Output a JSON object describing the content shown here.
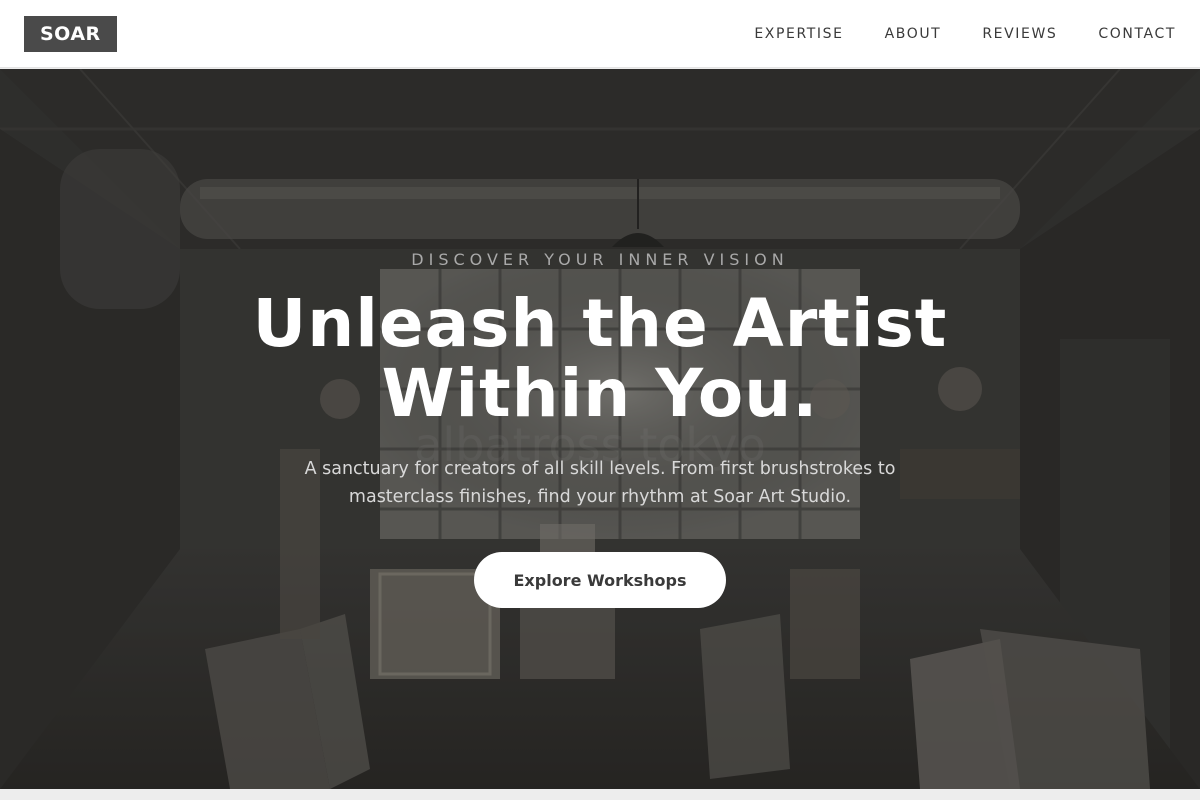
{
  "brand": {
    "logo_text": "SOAR"
  },
  "nav": {
    "items": [
      {
        "label": "EXPERTISE"
      },
      {
        "label": "ABOUT"
      },
      {
        "label": "REVIEWS"
      },
      {
        "label": "CONTACT"
      }
    ]
  },
  "hero": {
    "eyebrow": "DISCOVER YOUR INNER VISION",
    "headline": "Unleash the Artist Within You.",
    "subtext": "A sanctuary for creators of all skill levels. From first brushstrokes to masterclass finishes, find your rhythm at Soar Art Studio.",
    "cta_label": "Explore Workshops",
    "watermark": "albatross tokyo"
  },
  "colors": {
    "nav_background": "#ffffff",
    "logo_background": "#4a4a4a",
    "hero_overlay": "#2f2f2f",
    "cta_background": "#ffffff",
    "text_primary": "#ffffff"
  }
}
